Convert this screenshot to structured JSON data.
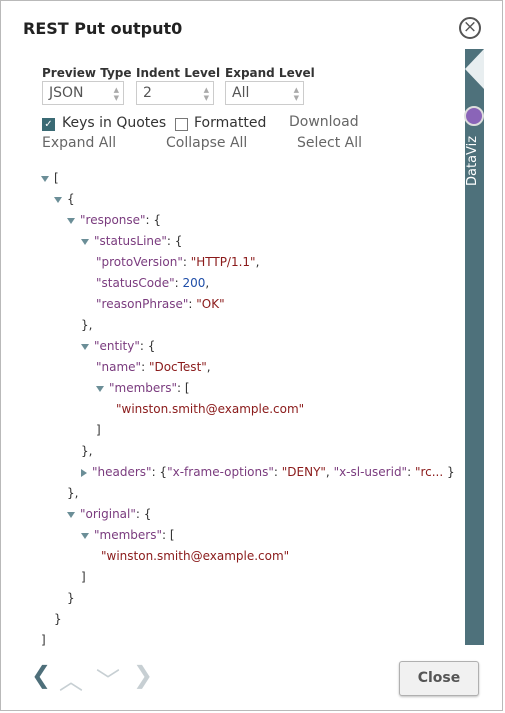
{
  "dialog": {
    "title": "REST Put output0",
    "close_icon_glyph": "×"
  },
  "controls": {
    "preview_type": {
      "label": "Preview Type",
      "value": "JSON"
    },
    "indent_level": {
      "label": "Indent Level",
      "value": "2"
    },
    "expand_level": {
      "label": "Expand Level",
      "value": "All"
    },
    "keys_in_quotes": {
      "label": "Keys in Quotes",
      "checked": true
    },
    "formatted": {
      "label": "Formatted",
      "checked": false
    },
    "download": "Download",
    "expand_all": "Expand All",
    "collapse_all": "Collapse All",
    "select_all": "Select All"
  },
  "sidebar": {
    "label": "DataViz"
  },
  "tree": {
    "open_bracket": "[",
    "open_brace": "{",
    "response_key": "\"response\"",
    "status_line_key": "\"statusLine\"",
    "proto_version_key": "\"protoVersion\"",
    "proto_version_value": "\"HTTP/1.1\"",
    "status_code_key": "\"statusCode\"",
    "status_code_value": "200",
    "reason_phrase_key": "\"reasonPhrase\"",
    "reason_phrase_value": "\"OK\"",
    "close_brace_comma": "},",
    "entity_key": "\"entity\"",
    "name_key": "\"name\"",
    "name_value": "\"DocTest\"",
    "members_key": "\"members\"",
    "member_value": "\"winston.smith@example.com\"",
    "close_bracket": "]",
    "headers_key": "\"headers\"",
    "headers_preview_key1": "\"x-frame-options\"",
    "headers_preview_val1": "\"DENY\"",
    "headers_preview_key2": "\"x-sl-userid\"",
    "headers_preview_val2": "\"rc...",
    "original_key": "\"original\"",
    "close_brace": "}"
  },
  "footer": {
    "close_button": "Close"
  }
}
